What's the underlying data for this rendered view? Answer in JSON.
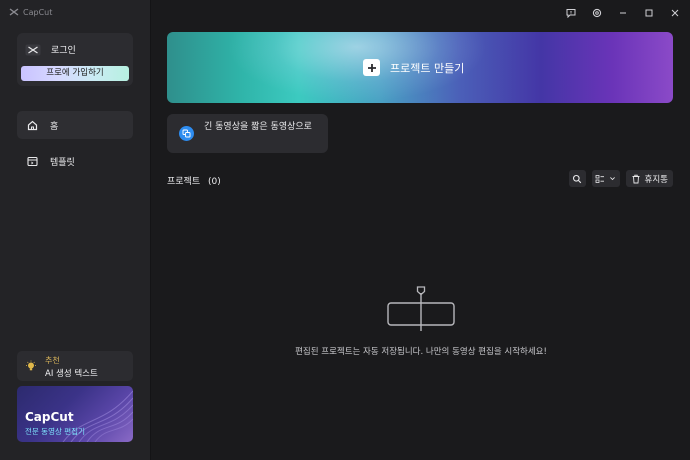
{
  "app": {
    "brand": "CapCut"
  },
  "sidebar": {
    "login_label": "로그인",
    "pro_button": "프로에 가입하기",
    "nav": [
      {
        "label": "홈",
        "icon": "home-icon",
        "active": true
      },
      {
        "label": "템플릿",
        "icon": "template-icon",
        "active": false
      }
    ],
    "ai_card": {
      "tag": "추천",
      "title": "AI 생성 텍스트"
    },
    "promo": {
      "title": "CapCut",
      "subtitle": "전문 동영상 편집기"
    }
  },
  "main": {
    "create_label": "프로젝트 만들기",
    "split_card_text": "긴 동영상을 짧은 동영상으로",
    "projects_title": "프로젝트",
    "projects_count": "(0)",
    "trash_label": "휴지통",
    "empty_message": "편집된 프로젝트는 자동 저장됩니다. 나만의 동영상 편집을 시작하세요!"
  },
  "colors": {
    "background": "#1a1a1c",
    "sidebar": "#232326",
    "card": "#2c2c30",
    "accent_blue": "#2d8cf0",
    "promo_cyan": "#7fe6ff"
  }
}
